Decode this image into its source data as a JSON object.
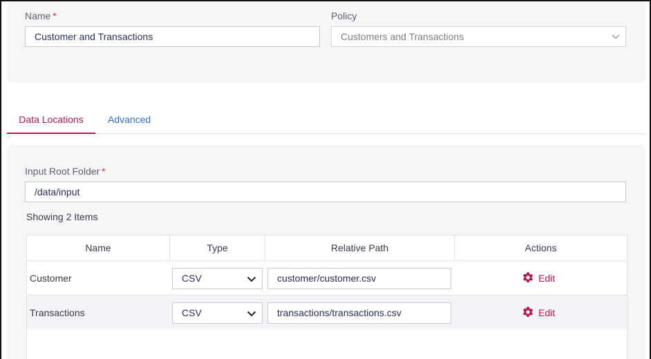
{
  "form": {
    "name_label": "Name",
    "name_required": "*",
    "name_value": "Customer and Transactions",
    "policy_label": "Policy",
    "policy_value": "Customers and Transactions"
  },
  "tabs": [
    {
      "label": "Data Locations",
      "active": true
    },
    {
      "label": "Advanced",
      "active": false
    }
  ],
  "data_locations": {
    "input_root_label": "Input Root Folder",
    "input_root_required": "*",
    "input_root_value": "/data/input",
    "showing_text": "Showing 2 Items",
    "columns": [
      "Name",
      "Type",
      "Relative Path",
      "Actions"
    ],
    "rows": [
      {
        "name": "Customer",
        "type": "CSV",
        "path": "customer/customer.csv",
        "action": "Edit"
      },
      {
        "name": "Transactions",
        "type": "CSV",
        "path": "transactions/transactions.csv",
        "action": "Edit"
      }
    ]
  },
  "colors": {
    "accent": "#b1184f",
    "link": "#2f6fce",
    "required": "#d0304f"
  }
}
